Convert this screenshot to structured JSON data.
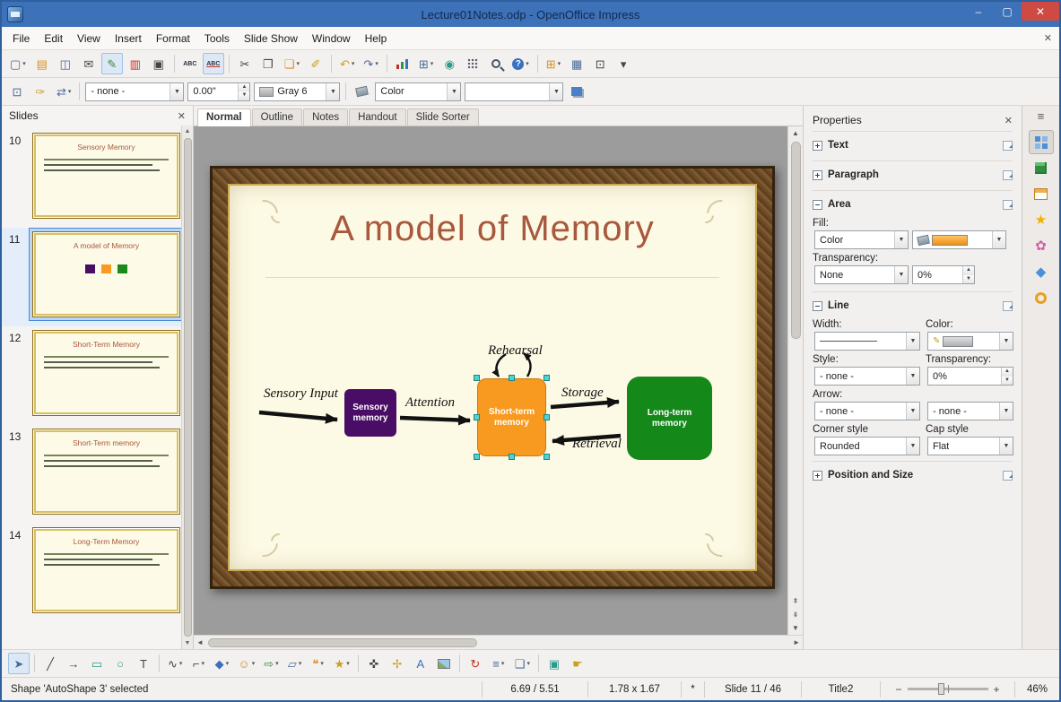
{
  "window": {
    "title": "Lecture01Notes.odp - OpenOffice Impress",
    "controls": [
      {
        "name": "minimize-button",
        "glyph": "–"
      },
      {
        "name": "maximize-button",
        "glyph": "▢"
      },
      {
        "name": "close-button",
        "glyph": "✕",
        "cls": "close"
      }
    ]
  },
  "menu": {
    "items": [
      {
        "name": "menu-file",
        "label": "File"
      },
      {
        "name": "menu-edit",
        "label": "Edit"
      },
      {
        "name": "menu-view",
        "label": "View"
      },
      {
        "name": "menu-insert",
        "label": "Insert"
      },
      {
        "name": "menu-format",
        "label": "Format"
      },
      {
        "name": "menu-tools",
        "label": "Tools"
      },
      {
        "name": "menu-slide-show",
        "label": "Slide Show"
      },
      {
        "name": "menu-window",
        "label": "Window"
      },
      {
        "name": "menu-help",
        "label": "Help"
      }
    ],
    "close_glyph": "✕"
  },
  "toolbar_main": {
    "items": [
      {
        "name": "new-icon",
        "glyph": "▢",
        "cls": "c-slate",
        "drop": true
      },
      {
        "name": "open-icon",
        "glyph": "▤",
        "cls": "c-amber"
      },
      {
        "name": "save-icon",
        "glyph": "◫",
        "cls": "c-slate"
      },
      {
        "name": "email-icon",
        "glyph": "✉",
        "cls": "c-dark"
      },
      {
        "name": "edit-file-icon",
        "glyph": "✎",
        "cls": "c-green",
        "toggled": true
      },
      {
        "name": "export-pdf-icon",
        "glyph": "▥",
        "cls": "c-red"
      },
      {
        "name": "print-icon",
        "glyph": "▣",
        "cls": "c-dark"
      },
      {
        "sep": true
      },
      {
        "name": "spelling-icon",
        "glyph": "ABC",
        "cls": "txt"
      },
      {
        "name": "autospellcheck-icon",
        "glyph": "ABC",
        "cls": "txt u-red",
        "toggled": true
      },
      {
        "sep": true
      },
      {
        "name": "cut-icon",
        "glyph": "✂",
        "cls": "c-dark"
      },
      {
        "name": "copy-icon",
        "glyph": "❐",
        "cls": "c-dark"
      },
      {
        "name": "paste-icon",
        "glyph": "❏",
        "cls": "c-amber",
        "drop": true
      },
      {
        "name": "clone-formatting-icon",
        "glyph": "✐",
        "cls": "c-gold"
      },
      {
        "sep": true
      },
      {
        "name": "undo-icon",
        "glyph": "↶",
        "cls": "c-gold",
        "drop": true
      },
      {
        "name": "redo-icon",
        "glyph": "↷",
        "cls": "c-slate",
        "drop": true
      },
      {
        "sep": true
      },
      {
        "name": "chart-icon",
        "cls": "g-chart"
      },
      {
        "name": "table-icon",
        "glyph": "⊞",
        "cls": "c-slate",
        "drop": true
      },
      {
        "name": "hyperlink-icon",
        "glyph": "◉",
        "cls": "c-teal"
      },
      {
        "name": "display-grid-icon",
        "cls": "g-grid"
      },
      {
        "name": "zoom-icon",
        "cls": "g-zoom"
      },
      {
        "name": "help-icon",
        "glyph": "?",
        "cls": "g-help",
        "drop": true
      },
      {
        "sep": true
      },
      {
        "name": "new-slide-icon",
        "glyph": "⊞",
        "cls": "c-amber",
        "drop": true
      },
      {
        "name": "slide-design-icon",
        "glyph": "▦",
        "cls": "c-slate"
      },
      {
        "name": "slide-show-icon",
        "glyph": "⊡",
        "cls": "c-dark"
      },
      {
        "name": "toolbar-options-icon",
        "glyph": "▾",
        "cls": "c-dark"
      }
    ]
  },
  "toolbar_line": {
    "icons_left": [
      {
        "name": "edit-points-icon",
        "glyph": "⊡",
        "cls": "c-slate"
      },
      {
        "name": "glue-points-icon",
        "glyph": "✑",
        "cls": "c-gold"
      },
      {
        "name": "arrow-style-icon",
        "glyph": "⇄",
        "cls": "c-slate",
        "drop": true
      }
    ],
    "style_value": "- none -",
    "width_value": "0.00\"",
    "color_value": "Gray 6",
    "fill_type_value": "Color"
  },
  "slides_panel": {
    "title": "Slides",
    "slides": [
      {
        "name": "slide-thumbnail-10",
        "number": "10",
        "title": "Sensory Memory",
        "cls": "text"
      },
      {
        "name": "slide-thumbnail-11",
        "number": "11",
        "title": "A model of Memory",
        "cls": "diagram",
        "selected": true
      },
      {
        "name": "slide-thumbnail-12",
        "number": "12",
        "title": "Short-Term Memory",
        "cls": "text"
      },
      {
        "name": "slide-thumbnail-13",
        "number": "13",
        "title": "Short-Term memory",
        "cls": "text"
      },
      {
        "name": "slide-thumbnail-14",
        "number": "14",
        "title": "Long-Term Memory",
        "cls": "text"
      }
    ]
  },
  "view_tabs": [
    {
      "name": "tab-normal",
      "label": "Normal",
      "selected": true
    },
    {
      "name": "tab-outline",
      "label": "Outline"
    },
    {
      "name": "tab-notes",
      "label": "Notes"
    },
    {
      "name": "tab-handout",
      "label": "Handout"
    },
    {
      "name": "tab-slide-sorter",
      "label": "Slide Sorter"
    }
  ],
  "slide": {
    "title": "A model of Memory",
    "boxes": {
      "sensory": "Sensory memory",
      "short": "Short-term memory",
      "long": "Long-term memory"
    },
    "labels": {
      "input": "Sensory Input",
      "attention": "Attention",
      "rehearsal": "Rehearsal",
      "storage": "Storage",
      "retrieval": "Retrieval"
    }
  },
  "properties": {
    "title": "Properties",
    "sections": {
      "text": "Text",
      "paragraph": "Paragraph",
      "area": "Area",
      "line": "Line",
      "possize": "Position and Size"
    },
    "area": {
      "fill_label": "Fill:",
      "fill_value": "Color",
      "transparency_label": "Transparency:",
      "transparency_value": "None",
      "transparency_pct": "0%"
    },
    "line": {
      "width_label": "Width:",
      "color_label": "Color:",
      "style_label": "Style:",
      "style_value": "- none -",
      "transparency_label": "Transparency:",
      "transparency_pct": "0%",
      "arrow_label": "Arrow:",
      "arrow_start": "- none -",
      "arrow_end": "- none -",
      "corner_label": "Corner style",
      "corner_value": "Rounded",
      "cap_label": "Cap style",
      "cap_value": "Flat"
    }
  },
  "sidebar_tabs": [
    {
      "name": "sidebar-properties-icon",
      "cls": "sb-props",
      "selected": true
    },
    {
      "name": "sidebar-gallery-icon",
      "cls": "sb-gallery"
    },
    {
      "name": "sidebar-master-pages-icon",
      "cls": "sb-master"
    },
    {
      "name": "sidebar-custom-animation-icon",
      "glyph": "★",
      "cls": "sb-anim"
    },
    {
      "name": "sidebar-slide-transition-icon",
      "glyph": "✿",
      "cls": "sb-trans"
    },
    {
      "name": "sidebar-styles-icon",
      "glyph": "◆",
      "cls": "sb-styles"
    },
    {
      "name": "sidebar-navigator-icon",
      "cls": "sb-nav"
    }
  ],
  "toolbar_draw": {
    "items": [
      {
        "name": "select-icon",
        "glyph": "➤",
        "cls": "c-slate",
        "toggled": true
      },
      {
        "sep": true
      },
      {
        "name": "line-icon",
        "glyph": "╱",
        "cls": "c-dark"
      },
      {
        "name": "line-arrow-icon",
        "glyph": "→",
        "cls": "c-dark"
      },
      {
        "name": "rectangle-icon",
        "glyph": "▭",
        "cls": "c-teal"
      },
      {
        "name": "ellipse-icon",
        "glyph": "○",
        "cls": "c-teal"
      },
      {
        "name": "text-icon",
        "glyph": "T",
        "cls": "c-dark"
      },
      {
        "sep": true
      },
      {
        "name": "curve-icon",
        "glyph": "∿",
        "cls": "c-dark",
        "drop": true
      },
      {
        "name": "connector-icon",
        "glyph": "⌐",
        "cls": "c-dark",
        "drop": true
      },
      {
        "name": "basic-shapes-icon",
        "glyph": "◆",
        "cls": "c-blue",
        "drop": true
      },
      {
        "name": "symbol-shapes-icon",
        "glyph": "☺",
        "cls": "c-amber",
        "drop": true
      },
      {
        "name": "block-arrows-icon",
        "glyph": "⇨",
        "cls": "c-green",
        "drop": true
      },
      {
        "name": "flowchart-icon",
        "glyph": "▱",
        "cls": "c-slate",
        "drop": true
      },
      {
        "name": "callouts-icon",
        "glyph": "❝",
        "cls": "c-amber",
        "drop": true
      },
      {
        "name": "stars-icon",
        "glyph": "★",
        "cls": "c-gold",
        "drop": true
      },
      {
        "sep": true
      },
      {
        "name": "edit-points-icon",
        "glyph": "✜",
        "cls": "c-dark"
      },
      {
        "name": "glue-points-icon",
        "glyph": "✢",
        "cls": "c-gold"
      },
      {
        "name": "fontwork-icon",
        "glyph": "A",
        "cls": "c-blue"
      },
      {
        "name": "from-file-icon",
        "cls": "g-pic"
      },
      {
        "sep": true
      },
      {
        "name": "rotate-icon",
        "glyph": "↻",
        "cls": "c-red"
      },
      {
        "name": "alignment-icon",
        "glyph": "≡",
        "cls": "c-slate",
        "drop": true
      },
      {
        "name": "arrange-icon",
        "glyph": "❏",
        "cls": "c-slate",
        "drop": true
      },
      {
        "sep": true
      },
      {
        "name": "extrusion-icon",
        "glyph": "▣",
        "cls": "c-teal"
      },
      {
        "name": "interaction-icon",
        "glyph": "☛",
        "cls": "c-gold"
      }
    ]
  },
  "statusbar": {
    "selection": "Shape 'AutoShape 3' selected",
    "position": "6.69 / 5.51",
    "size": "1.78 x 1.67",
    "modified": "*",
    "slide": "Slide 11 / 46",
    "layout": "Title2",
    "zoom_pct": "46%",
    "zoom_minus": "−",
    "zoom_plus": "+"
  }
}
